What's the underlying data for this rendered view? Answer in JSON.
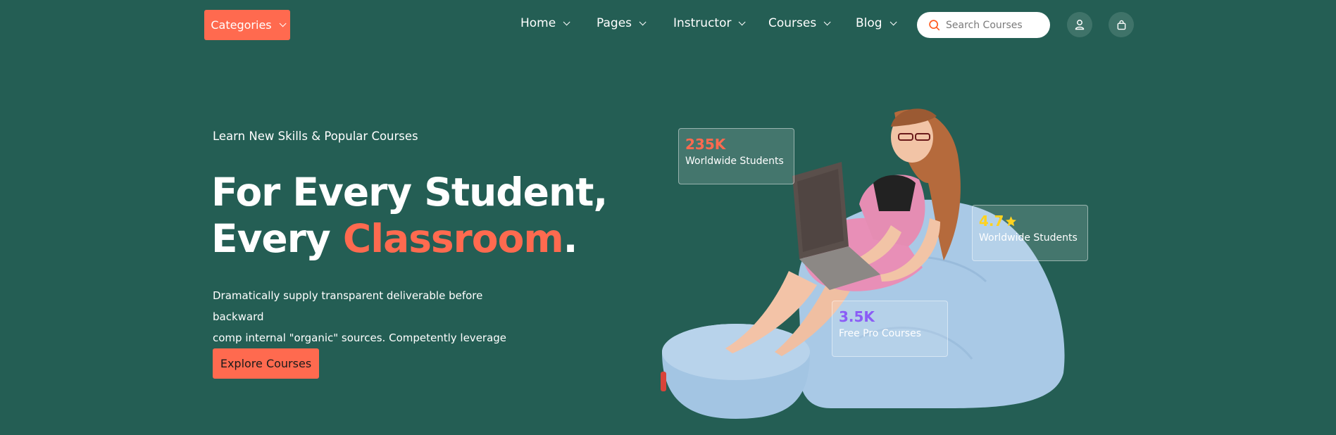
{
  "header": {
    "categories_label": "Categories",
    "nav": [
      {
        "label": "Home"
      },
      {
        "label": "Pages"
      },
      {
        "label": "Instructor"
      },
      {
        "label": "Courses"
      },
      {
        "label": "Blog"
      }
    ],
    "search": {
      "placeholder": "Search Courses",
      "value": ""
    },
    "icons": {
      "search": "search-icon",
      "user": "user-icon",
      "cart": "shopping-bag-icon",
      "dropdown": "chevron-down-icon"
    }
  },
  "hero": {
    "eyebrow": "Learn New Skills & Popular Courses",
    "title_line1": "For Every Student,",
    "title_line2_prefix": "Every ",
    "title_line2_accent": "Classroom",
    "title_line2_suffix": ".",
    "description_line1": "Dramatically supply transparent deliverable before backward",
    "description_line2": "comp internal \"organic\" sources. Competently leverage other.",
    "cta_label": "Explore Courses"
  },
  "stats": [
    {
      "value": "235K",
      "label": "Worldwide Students",
      "color": "#ff6a4f"
    },
    {
      "value": "4.7",
      "label": "Worldwide Students",
      "color": "#ffd21f",
      "icon": "star-icon"
    },
    {
      "value": "3.5K",
      "label": "Free Pro Courses",
      "color": "#8b5cf6"
    }
  ],
  "colors": {
    "background": "#245e54",
    "accent": "#ff6a4f",
    "white": "#ffffff"
  }
}
